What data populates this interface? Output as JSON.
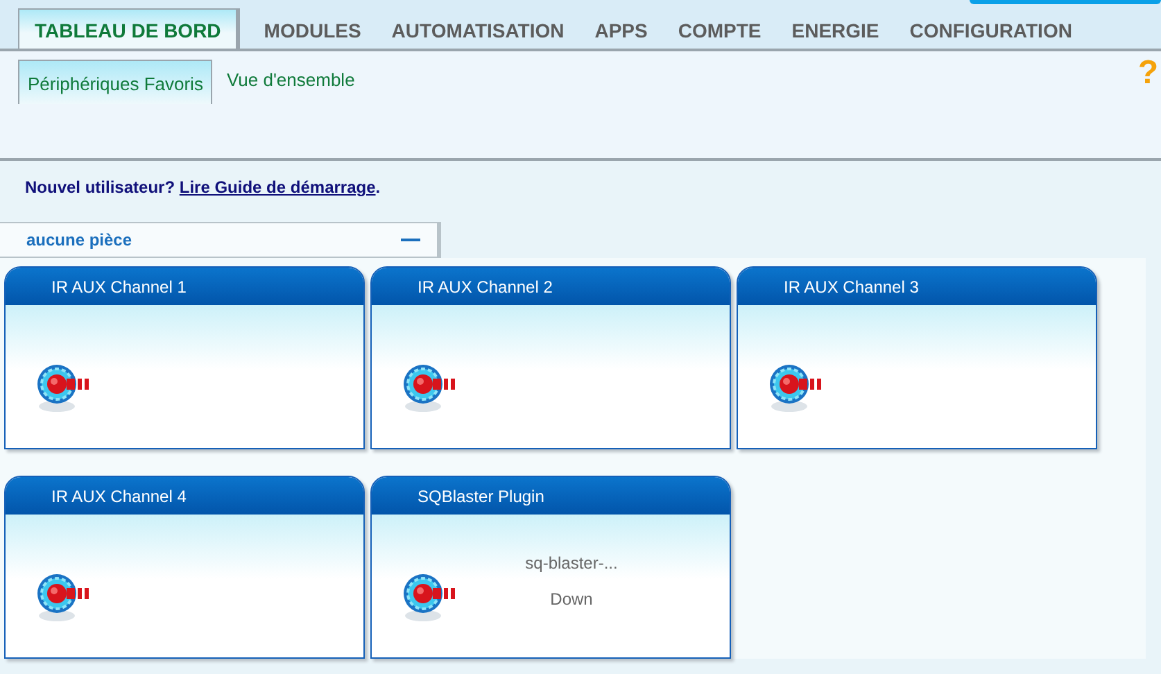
{
  "nav_tabs": [
    {
      "label": "TABLEAU DE BORD",
      "selected": true
    },
    {
      "label": "MODULES",
      "selected": false
    },
    {
      "label": "AUTOMATISATION",
      "selected": false
    },
    {
      "label": "APPS",
      "selected": false
    },
    {
      "label": "COMPTE",
      "selected": false
    },
    {
      "label": "ENERGIE",
      "selected": false
    },
    {
      "label": "CONFIGURATION",
      "selected": false
    }
  ],
  "sub_tabs": [
    {
      "label": "Périphériques Favoris",
      "selected": true
    },
    {
      "label": "Vue d'ensemble",
      "selected": false
    }
  ],
  "help": "?",
  "notice": {
    "text": "Nouvel utilisateur?",
    "link": "Lire Guide de démarrage",
    "end": "."
  },
  "room": {
    "name": "aucune pièce",
    "expanded": true
  },
  "devices": [
    {
      "title": "IR AUX Channel 1"
    },
    {
      "title": "IR AUX Channel 2"
    },
    {
      "title": "IR AUX Channel 3"
    },
    {
      "title": "IR AUX Channel 4"
    },
    {
      "title": "SQBlaster Plugin",
      "lines": [
        "sq-blaster-...",
        "Down"
      ]
    }
  ]
}
